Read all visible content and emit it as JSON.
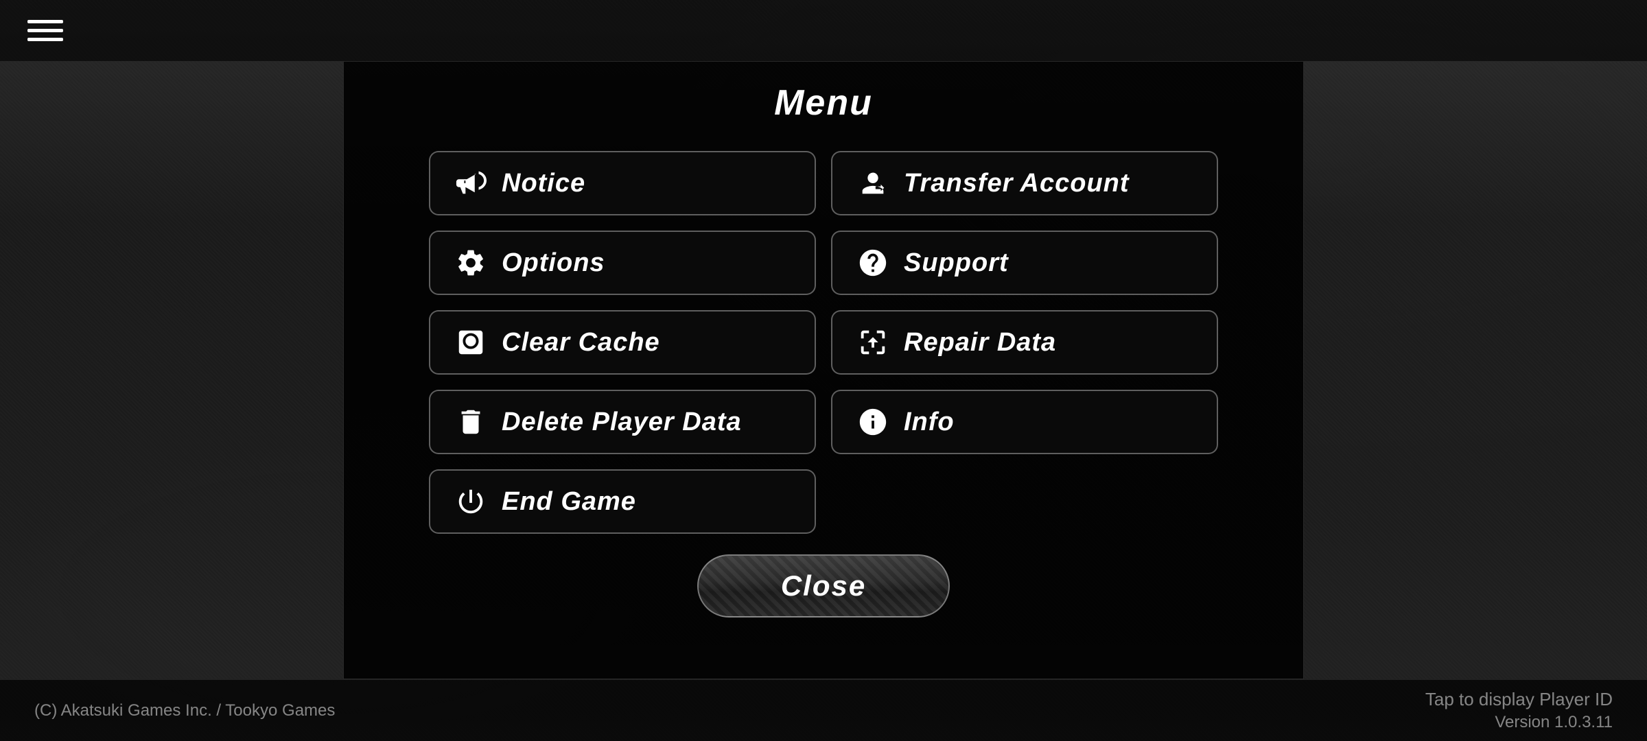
{
  "topBar": {
    "hamburger": "☰"
  },
  "menu": {
    "title": "Menu",
    "buttons": [
      {
        "id": "notice",
        "label": "Notice",
        "icon": "megaphone",
        "col": 0
      },
      {
        "id": "transfer-account",
        "label": "Transfer Account",
        "icon": "transfer",
        "col": 1
      },
      {
        "id": "options",
        "label": "Options",
        "icon": "gear",
        "col": 0
      },
      {
        "id": "support",
        "label": "Support",
        "icon": "question",
        "col": 1
      },
      {
        "id": "clear-cache",
        "label": "Clear Cache",
        "icon": "clearcache",
        "col": 0
      },
      {
        "id": "repair-data",
        "label": "Repair Data",
        "icon": "repair",
        "col": 1
      },
      {
        "id": "delete-player-data",
        "label": "Delete Player Data",
        "icon": "trash",
        "col": 0
      },
      {
        "id": "info",
        "label": "Info",
        "icon": "info",
        "col": 1
      }
    ],
    "singleButton": {
      "id": "end-game",
      "label": "End Game",
      "icon": "power"
    },
    "closeLabel": "Close"
  },
  "bottomBar": {
    "copyright": "(C) Akatsuki Games Inc. / Tookyo Games",
    "tapPlayerId": "Tap to display Player ID",
    "version": "Version 1.0.3.11"
  }
}
